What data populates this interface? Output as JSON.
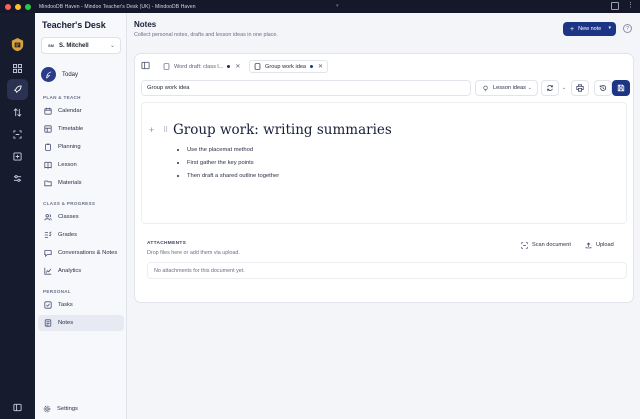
{
  "window": {
    "title": "MindooDB Haven - Mindoo Teacher's Desk (UK) - MindooDB Haven"
  },
  "rail": {
    "items": [
      {
        "icon": "grid-icon"
      },
      {
        "icon": "rocket-icon",
        "active": true
      },
      {
        "icon": "arrows-updown-icon"
      },
      {
        "icon": "scan-icon"
      },
      {
        "icon": "import-icon"
      },
      {
        "icon": "sliders-icon"
      }
    ],
    "bottom_icon": "panel-icon"
  },
  "sidebar": {
    "brand": "Teacher's Desk",
    "user_initials": "SM",
    "user_name": "S. Mitchell",
    "today_label": "Today",
    "sections": [
      {
        "title": "PLAN & TEACH",
        "items": [
          {
            "label": "Calendar",
            "icon": "calendar-icon"
          },
          {
            "label": "Timetable",
            "icon": "table-icon"
          },
          {
            "label": "Planning",
            "icon": "clipboard-icon"
          },
          {
            "label": "Lesson",
            "icon": "book-icon"
          },
          {
            "label": "Materials",
            "icon": "folder-icon"
          }
        ]
      },
      {
        "title": "CLASS & PROGRESS",
        "items": [
          {
            "label": "Classes",
            "icon": "users-icon"
          },
          {
            "label": "Grades",
            "icon": "grades-icon"
          },
          {
            "label": "Conversations & Notes",
            "icon": "chat-icon"
          },
          {
            "label": "Analytics",
            "icon": "chart-icon"
          }
        ]
      },
      {
        "title": "PERSONAL",
        "items": [
          {
            "label": "Tasks",
            "icon": "check-icon"
          },
          {
            "label": "Notes",
            "icon": "note-icon",
            "active": true
          }
        ]
      }
    ],
    "settings_label": "Settings"
  },
  "main": {
    "title": "Notes",
    "subtitle": "Collect personal notes, drafts and lesson ideas in one place.",
    "new_note_label": "New note",
    "tabs": [
      {
        "label": "Word draft: class l...",
        "unsaved": true,
        "active": false
      },
      {
        "label": "Group work idea",
        "unsaved": true,
        "active": true
      }
    ],
    "title_field_value": "Group work idea",
    "type_select_value": "Lesson ideas",
    "editor": {
      "heading": "Group work: writing summaries",
      "bullets": [
        "Use the placemat method",
        "First gather the key points",
        "Then draft a shared outline together"
      ]
    },
    "attachments": {
      "header": "ATTACHMENTS",
      "hint": "Drop files here or add them via upload.",
      "scan_label": "Scan document",
      "upload_label": "Upload",
      "empty_text": "No attachments for this document yet."
    }
  },
  "colors": {
    "accent": "#1d3585",
    "rail_bg": "#171b2e",
    "titlebar_bg": "#14182a",
    "traffic_red": "#ff5f57",
    "traffic_yellow": "#febc2e",
    "traffic_green": "#28c840"
  }
}
